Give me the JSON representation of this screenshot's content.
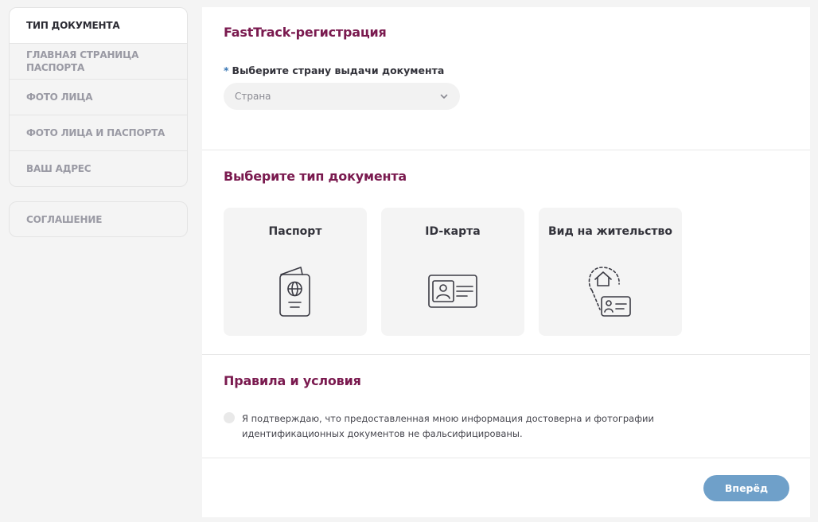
{
  "sidebar": {
    "steps": [
      {
        "label": "ТИП ДОКУМЕНТА"
      },
      {
        "label": "ГЛАВНАЯ СТРАНИЦА ПАСПОРТА"
      },
      {
        "label": "ФОТО ЛИЦА"
      },
      {
        "label": "ФОТО ЛИЦА И ПАСПОРТА"
      },
      {
        "label": "ВАШ АДРЕС"
      }
    ],
    "extra": {
      "label": "СОГЛАШЕНИЕ"
    }
  },
  "registration": {
    "title": "FastTrack-регистрация",
    "required_mark": "*",
    "country_label": "Выберите страну выдачи документа",
    "country_value": "Страна"
  },
  "document_type": {
    "title": "Выберите тип документа",
    "options": [
      {
        "label": "Паспорт",
        "icon": "passport-icon"
      },
      {
        "label": "ID-карта",
        "icon": "id-card-icon"
      },
      {
        "label": "Вид на жительство",
        "icon": "residence-permit-icon"
      }
    ]
  },
  "terms": {
    "title": "Правила и условия",
    "confirm_text": "Я подтверждаю, что предоставленная мною информация достоверна и фотографии идентификационных документов не фальсифицированы."
  },
  "actions": {
    "next_label": "Вперёд"
  },
  "colors": {
    "heading": "#7a1a4f",
    "primary_button": "#6fa0c9",
    "background": "#f4f4f4"
  }
}
